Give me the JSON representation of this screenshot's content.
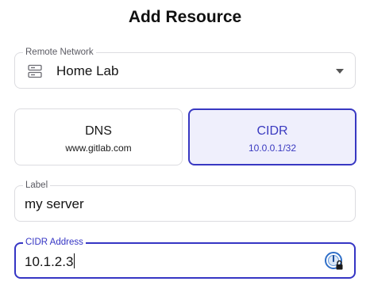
{
  "title": "Add Resource",
  "remote_network": {
    "label": "Remote Network",
    "value": "Home Lab",
    "icon": "server-icon"
  },
  "resource_type": {
    "options": [
      {
        "title": "DNS",
        "example": "www.gitlab.com",
        "selected": false
      },
      {
        "title": "CIDR",
        "example": "10.0.0.1/32",
        "selected": true
      }
    ]
  },
  "label_field": {
    "label": "Label",
    "value": "my server"
  },
  "cidr_field": {
    "label": "CIDR Address",
    "value": "10.1.2.3",
    "icon": "password-manager-lock-icon"
  },
  "colors": {
    "accent": "#3535c4",
    "accent_bg": "#efeffc",
    "border": "#dcdce0"
  }
}
